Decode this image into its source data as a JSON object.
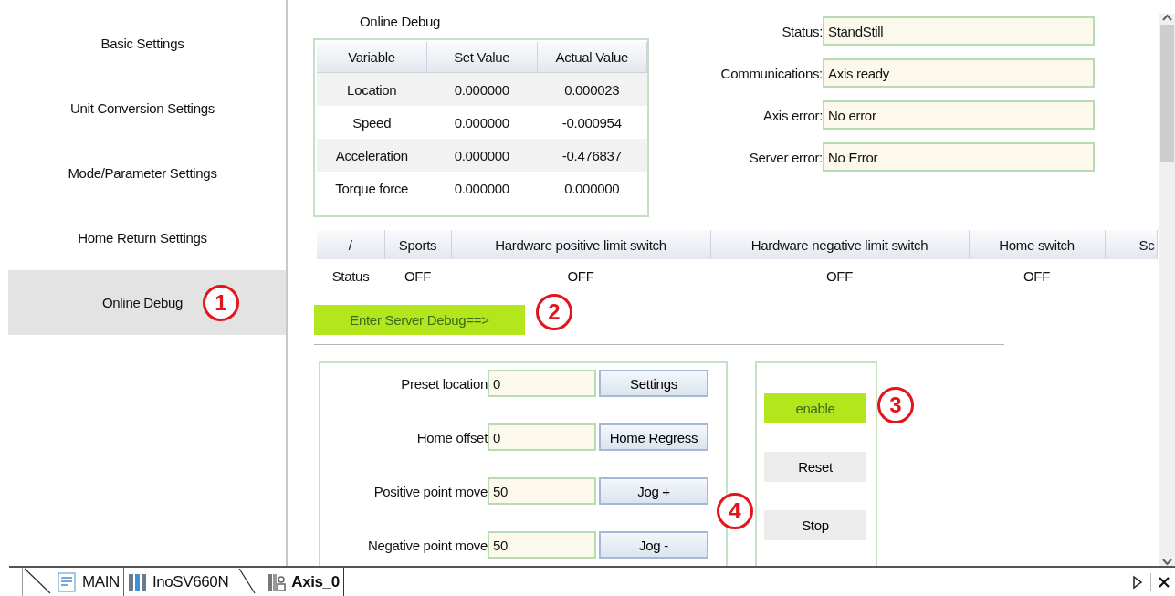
{
  "sidebar": {
    "items": [
      {
        "label": "Basic Settings",
        "selected": false
      },
      {
        "label": "Unit Conversion Settings",
        "selected": false
      },
      {
        "label": "Mode/Parameter Settings",
        "selected": false
      },
      {
        "label": "Home Return Settings",
        "selected": false
      },
      {
        "label": "Online Debug",
        "selected": true
      }
    ]
  },
  "debug": {
    "title": "Online Debug",
    "variables": {
      "columns": [
        "Variable",
        "Set Value",
        "Actual Value"
      ],
      "rows": [
        [
          "Location",
          "0.000000",
          "0.000023"
        ],
        [
          "Speed",
          "0.000000",
          "-0.000954"
        ],
        [
          "Acceleration",
          "0.000000",
          "-0.476837"
        ],
        [
          "Torque force",
          "0.000000",
          "0.000000"
        ]
      ]
    },
    "status_fields": [
      {
        "label": "Status:",
        "value": "StandStill"
      },
      {
        "label": "Communications:",
        "value": "Axis ready"
      },
      {
        "label": "Axis error:",
        "value": "No error"
      },
      {
        "label": "Server error:",
        "value": "No Error"
      }
    ]
  },
  "switch_table": {
    "columns": [
      "/",
      "Sports",
      "Hardware positive limit switch",
      "Hardware negative limit switch",
      "Home switch",
      "Sc"
    ],
    "rows": [
      [
        "Status",
        "OFF",
        "OFF",
        "OFF",
        "OFF"
      ]
    ]
  },
  "server_debug_button": "Enter Server Debug==>",
  "point_moves": [
    {
      "label": "Preset location",
      "value": "0",
      "button": "Settings"
    },
    {
      "label": "Home offset",
      "value": "0",
      "button": "Home Regress"
    },
    {
      "label": "Positive point move",
      "value": "50",
      "button": "Jog +"
    },
    {
      "label": "Negative point move",
      "value": "50",
      "button": "Jog -"
    }
  ],
  "control_buttons": [
    {
      "label": "enable",
      "active": true
    },
    {
      "label": "Reset",
      "active": false
    },
    {
      "label": "Stop",
      "active": false
    }
  ],
  "annotations": [
    "1",
    "2",
    "3",
    "4"
  ],
  "editor_tabs": [
    {
      "label": "MAIN",
      "kind": "program",
      "selected": false
    },
    {
      "label": "InoSV660N",
      "kind": "device",
      "selected": false
    },
    {
      "label": "Axis_0",
      "kind": "axis",
      "selected": true
    }
  ]
}
